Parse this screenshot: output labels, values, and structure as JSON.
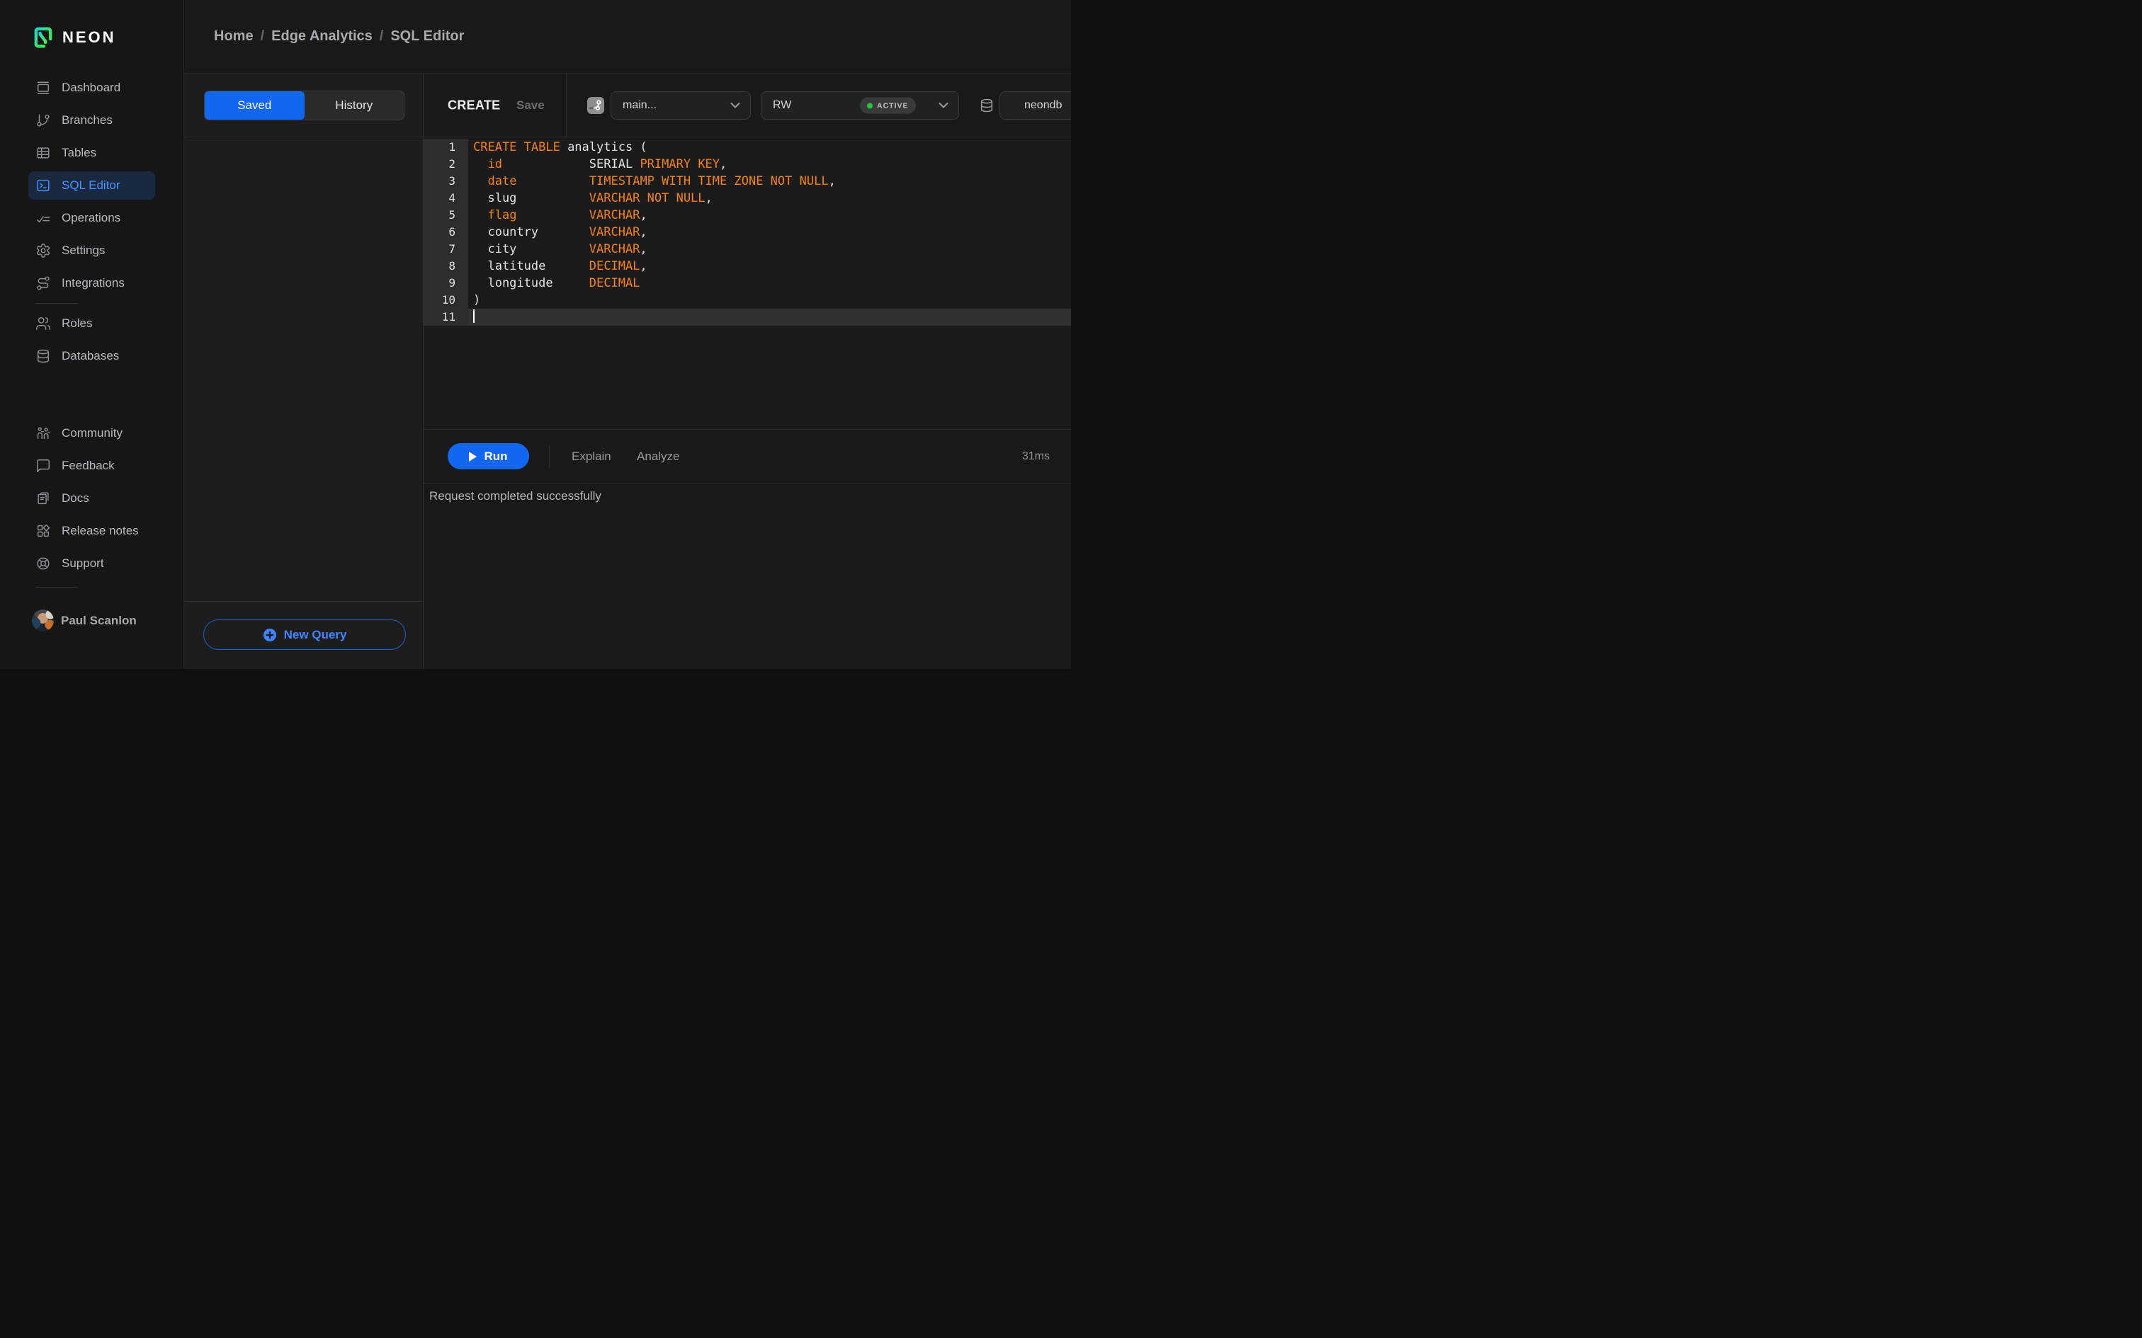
{
  "brand": {
    "name": "NEON"
  },
  "colors": {
    "accent_blue": "#1167ef",
    "keyword_orange": "#f5820d",
    "active_green": "#27c447",
    "editor_bg": "#1b1b1b",
    "active_nav_bg": "#1a2940"
  },
  "sidebar": {
    "groups": [
      {
        "items": [
          {
            "label": "Dashboard",
            "icon": "dashboard"
          },
          {
            "label": "Branches",
            "icon": "branches"
          },
          {
            "label": "Tables",
            "icon": "tables"
          },
          {
            "label": "SQL Editor",
            "icon": "sql-editor",
            "active": true
          },
          {
            "label": "Operations",
            "icon": "operations"
          },
          {
            "label": "Settings",
            "icon": "settings"
          },
          {
            "label": "Integrations",
            "icon": "integrations"
          }
        ]
      },
      {
        "items": [
          {
            "label": "Roles",
            "icon": "roles"
          },
          {
            "label": "Databases",
            "icon": "databases"
          }
        ]
      },
      {
        "items": [
          {
            "label": "Community",
            "icon": "community"
          },
          {
            "label": "Feedback",
            "icon": "feedback"
          },
          {
            "label": "Docs",
            "icon": "docs"
          },
          {
            "label": "Release notes",
            "icon": "release-notes"
          },
          {
            "label": "Support",
            "icon": "support"
          }
        ]
      }
    ],
    "user": {
      "name": "Paul Scanlon",
      "avatar_icon": "user-photo-avatar"
    }
  },
  "breadcrumb": {
    "items": [
      "Home",
      "Edge Analytics",
      "SQL Editor"
    ],
    "separator": "/"
  },
  "queries_panel": {
    "tabs": [
      {
        "label": "Saved",
        "active": true
      },
      {
        "label": "History",
        "active": false
      }
    ],
    "new_query_label": "New Query",
    "new_query_icon": "plus-circle-icon"
  },
  "editor": {
    "title": "CREATE",
    "save_label": "Save",
    "branch_button_icon": "git-branch-icon",
    "branch_select": {
      "value": "main...",
      "icon": "chevron-down-icon"
    },
    "endpoint_select": {
      "value": "RW",
      "status": "ACTIVE",
      "icon": "chevron-down-icon"
    },
    "database_icon": "database-icon",
    "database_select": {
      "value": "neondb"
    },
    "code": {
      "lines": [
        {
          "n": 1,
          "tokens": [
            [
              "CREATE TABLE",
              "kw"
            ],
            [
              " analytics (",
              "d"
            ]
          ]
        },
        {
          "n": 2,
          "tokens": [
            [
              "  ",
              "d"
            ],
            [
              "id",
              "kw"
            ],
            [
              "            SERIAL ",
              "d"
            ],
            [
              "PRIMARY KEY",
              "kw"
            ],
            [
              ",",
              "d"
            ]
          ]
        },
        {
          "n": 3,
          "tokens": [
            [
              "  ",
              "d"
            ],
            [
              "date",
              "kw"
            ],
            [
              "          ",
              "d"
            ],
            [
              "TIMESTAMP WITH TIME ZONE NOT NULL",
              "kw"
            ],
            [
              ",",
              "d"
            ]
          ]
        },
        {
          "n": 4,
          "tokens": [
            [
              "  slug          ",
              "d"
            ],
            [
              "VARCHAR NOT NULL",
              "kw"
            ],
            [
              ",",
              "d"
            ]
          ]
        },
        {
          "n": 5,
          "tokens": [
            [
              "  ",
              "d"
            ],
            [
              "flag",
              "kw"
            ],
            [
              "          ",
              "d"
            ],
            [
              "VARCHAR",
              "kw"
            ],
            [
              ",",
              "d"
            ]
          ]
        },
        {
          "n": 6,
          "tokens": [
            [
              "  country       ",
              "d"
            ],
            [
              "VARCHAR",
              "kw"
            ],
            [
              ",",
              "d"
            ]
          ]
        },
        {
          "n": 7,
          "tokens": [
            [
              "  city          ",
              "d"
            ],
            [
              "VARCHAR",
              "kw"
            ],
            [
              ",",
              "d"
            ]
          ]
        },
        {
          "n": 8,
          "tokens": [
            [
              "  latitude      ",
              "d"
            ],
            [
              "DECIMAL",
              "kw"
            ],
            [
              ",",
              "d"
            ]
          ]
        },
        {
          "n": 9,
          "tokens": [
            [
              "  longitude     ",
              "d"
            ],
            [
              "DECIMAL",
              "kw"
            ]
          ]
        },
        {
          "n": 10,
          "tokens": [
            [
              ")",
              "d"
            ]
          ]
        },
        {
          "n": 11,
          "tokens": [],
          "active": true
        }
      ]
    },
    "actions": {
      "run": "Run",
      "run_icon": "play-icon",
      "explain": "Explain",
      "analyze": "Analyze",
      "duration": "31ms"
    },
    "status_message": "Request completed successfully"
  }
}
